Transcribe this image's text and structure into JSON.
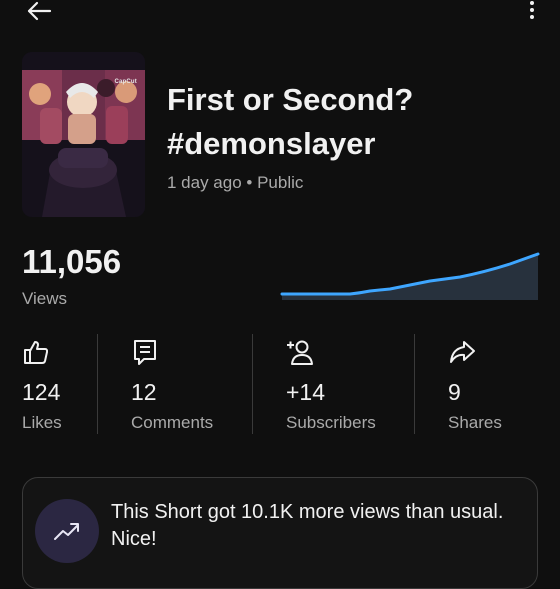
{
  "header": {
    "back_icon": "arrow-left-icon",
    "more_icon": "more-vertical-icon"
  },
  "video": {
    "title": "First or Second? #demonslayer",
    "meta": "1 day ago • Public",
    "thumbnail_watermark": "CapCut"
  },
  "views": {
    "count": "11,056",
    "label": "Views",
    "trend_color": "#3ea6ff"
  },
  "stats": [
    {
      "icon": "thumbs-up-icon",
      "value": "124",
      "label": "Likes"
    },
    {
      "icon": "comment-icon",
      "value": "12",
      "label": "Comments"
    },
    {
      "icon": "add-person-icon",
      "value": "+14",
      "label": "Subscribers"
    },
    {
      "icon": "share-icon",
      "value": "9",
      "label": "Shares"
    }
  ],
  "insight": {
    "icon": "trending-up-icon",
    "text": "This Short got 10.1K more views than usual. Nice!"
  },
  "colors": {
    "background": "#0f0f0f",
    "text_primary": "#f1f1f1",
    "text_secondary": "#aaaaaa",
    "accent": "#3ea6ff"
  }
}
